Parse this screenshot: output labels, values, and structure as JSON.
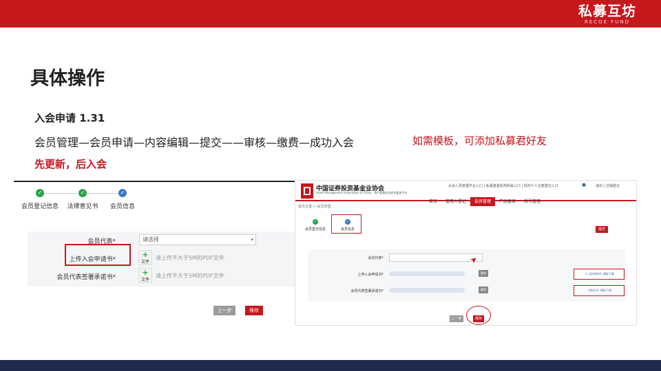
{
  "brand": {
    "name": "私募互坊",
    "sub": "RECOE FUND"
  },
  "slide": {
    "title": "具体操作",
    "subtitle": "入会申请 1.31",
    "flow": "会员管理—会员申请—内容编辑—提交——审核—缴费—成功入会",
    "tip": "如需模板，可添加私募君好友",
    "update_note": "先更新，后入会"
  },
  "left": {
    "steps": [
      "会员登记信息",
      "法律意见书",
      "会员信息"
    ],
    "rows": [
      {
        "label": "会员代表*",
        "select": "请选择"
      },
      {
        "label": "上传入会申请书*",
        "upload": "文件",
        "hint": "请上传不大于5M的PDF文件"
      },
      {
        "label": "会员代表签署承诺书*",
        "upload": "文件",
        "hint": "请上传不大于5M的PDF文件"
      }
    ],
    "prev_label": "上一步",
    "save_label": "保存"
  },
  "right": {
    "org_name": "中国证券投资基金业协会",
    "org_sub": "Asset Management Association of China · 资产管理业务综合报送平台",
    "top_links": "从会入员管理平台入口 | 私募基金机构所属入口 | 机构个人注册登记入口",
    "tool_links": "退出 | 注销登记",
    "nav": [
      "首页",
      "管理人登记",
      "会员管理",
      "产品备案",
      "账号管理"
    ],
    "nav_active": 2,
    "breadcrumb": "首页位置 > 会员管理",
    "steps": [
      "会员登记信息",
      "会员信息"
    ],
    "submit_label": "提交",
    "rows": [
      {
        "label": "会员代表*"
      },
      {
        "label": "上传入会申请书*",
        "del": "删除",
        "link": "《入会申请书》模板下载"
      },
      {
        "label": "会员代表签署承诺书*",
        "del": "删除",
        "link": "《承诺书》模板下载"
      }
    ],
    "prev_label": "上一步",
    "save_label": "保存"
  }
}
